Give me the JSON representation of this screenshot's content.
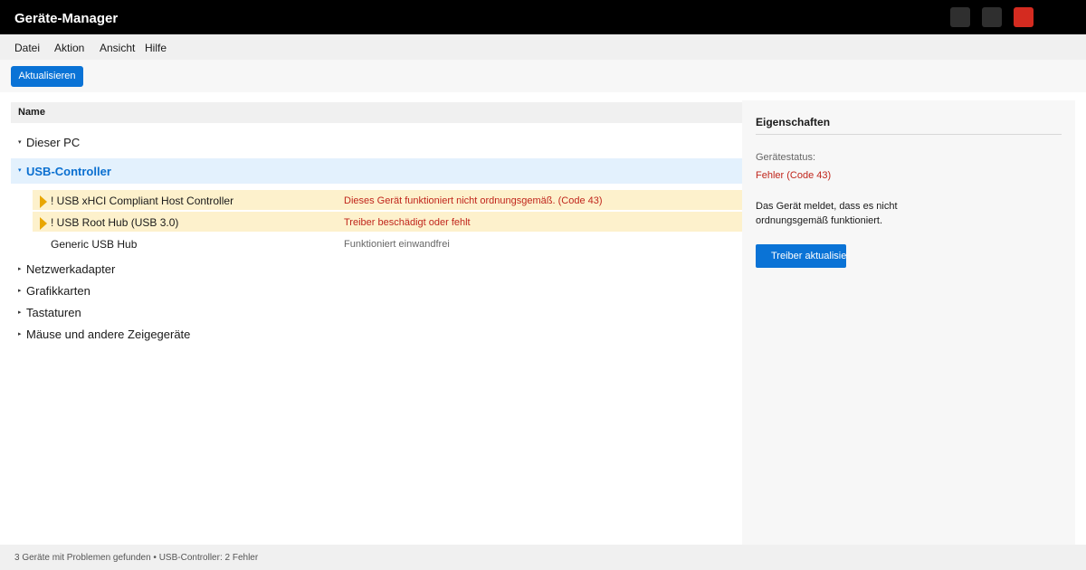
{
  "window": {
    "title": "Geräte-Manager"
  },
  "menu": [
    "Datei",
    "Aktion",
    "Ansicht",
    "Hilfe"
  ],
  "toolbar": {
    "refresh_label": "Aktualisieren"
  },
  "tree": {
    "column_header": "Name",
    "nodes": [
      {
        "label": "Dieser PC",
        "expanded": true
      },
      {
        "label": "USB-Controller",
        "expanded": true,
        "selected": true
      },
      {
        "label": "Netzwerkadapter",
        "expanded": false
      },
      {
        "label": "Grafikkarten",
        "expanded": false
      },
      {
        "label": "Tastaturen",
        "expanded": false
      },
      {
        "label": "Mäuse und andere Zeigegeräte",
        "expanded": false
      }
    ],
    "arrow_expanded": "▾",
    "arrow_collapsed": "▸",
    "devices": [
      {
        "name": "! USB xHCI Compliant Host Controller",
        "status": "Dieses Gerät funktioniert nicht ordnungsgemäß. (Code 43)",
        "warning": true
      },
      {
        "name": "! USB Root Hub (USB 3.0)",
        "status": "Treiber beschädigt oder fehlt",
        "warning": true
      },
      {
        "name": "Generic USB Hub",
        "status": "Funktioniert einwandfrei",
        "warning": false
      }
    ]
  },
  "properties": {
    "title": "Eigenschaften",
    "status_label": "Gerätestatus:",
    "status_value": "Fehler (Code 43)",
    "description": "Das Gerät meldet, dass es nicht ordnungsgemäß funktioniert.",
    "button_label": "Treiber aktualisieren"
  },
  "statusbar": {
    "text": "3 Geräte mit Problemen gefunden • USB-Controller: 2 Fehler"
  },
  "colors": {
    "accent": "#0a73d6",
    "error": "#c0261c",
    "warning_bg": "#fdf1cc",
    "warning_icon": "#e8a600",
    "selection_bg": "#e3f1fd",
    "close_button": "#d42b20"
  }
}
